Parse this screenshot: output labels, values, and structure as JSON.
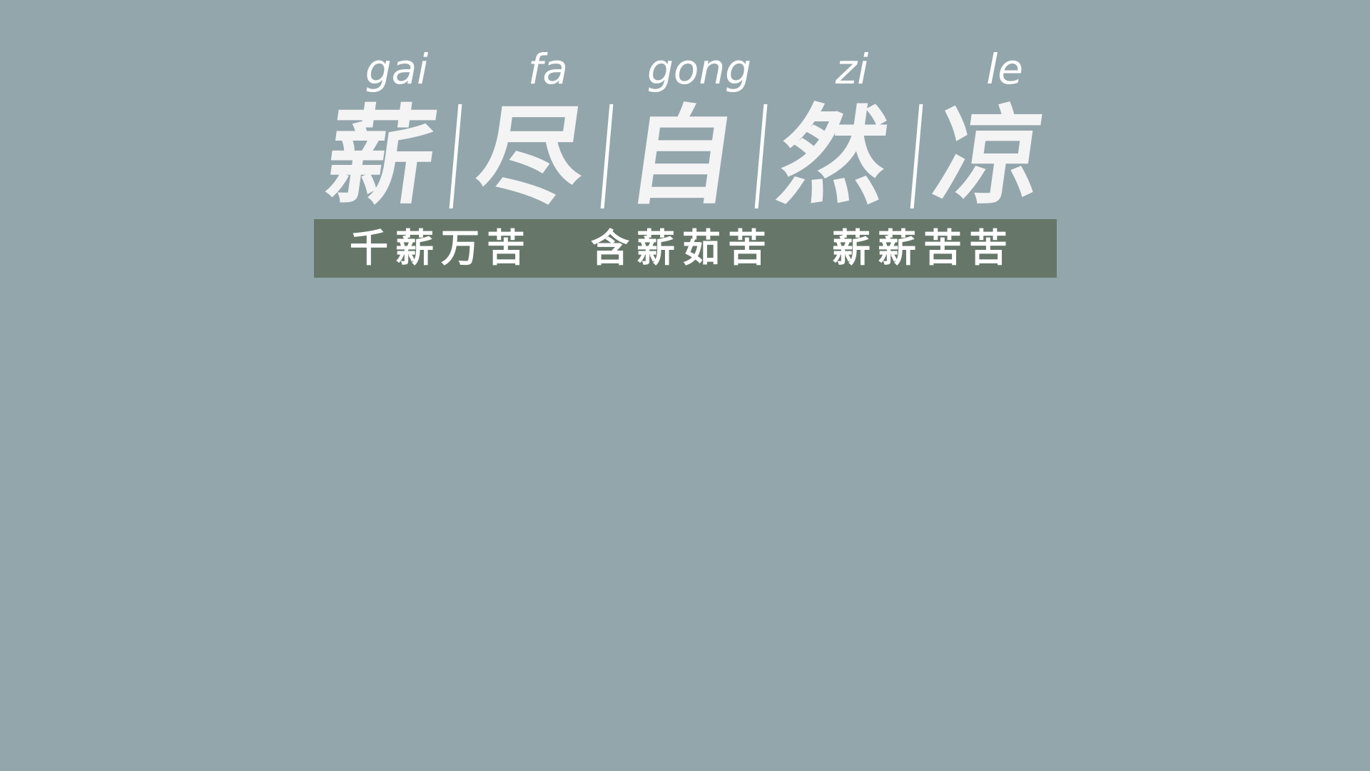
{
  "headline": {
    "pinyin": [
      "gai",
      "fa",
      "gong",
      "zi",
      "le"
    ],
    "characters": [
      "薪",
      "尽",
      "自",
      "然",
      "凉"
    ]
  },
  "banner": {
    "phrases": [
      "千薪万苦",
      "含薪茹苦",
      "薪薪苦苦"
    ]
  },
  "colors": {
    "background": "#93a6ac",
    "banner": "#667769",
    "text": "#ffffff"
  }
}
